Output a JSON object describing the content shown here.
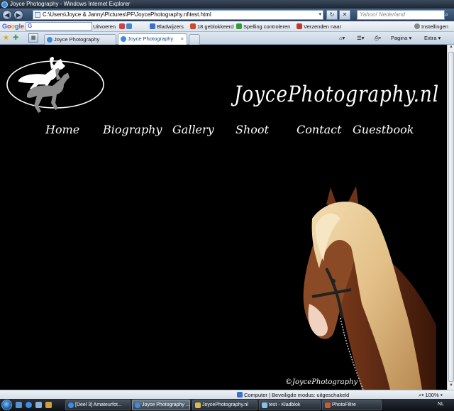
{
  "window": {
    "title": "Joyce Photography - Windows Internet Explorer"
  },
  "address_bar": {
    "url": "C:\\Users\\Joyce & Janny\\Pictures\\PF\\JoycePhotography.nl\\test.html",
    "search_placeholder": "Yahoo! Nederland"
  },
  "google_toolbar": {
    "logo": "Google",
    "go_label": "Uitvoeren",
    "bookmarks_label": "Bladwijzers",
    "blocked_label": "18 geblokkeerd",
    "spellcheck_label": "Spelling controleren",
    "send_label": "Verzenden naar",
    "settings_label": "Instellingen"
  },
  "tabs": [
    {
      "label": "Joyce Photography",
      "active": false
    },
    {
      "label": "Joyce Photography",
      "active": true
    }
  ],
  "command_bar": {
    "page_label": "Pagina",
    "extra_label": "Extra"
  },
  "page": {
    "site_title": "JoycePhotography.nl",
    "nav": [
      "Home",
      "Biography",
      "Gallery",
      "Shoot",
      "Contact",
      "Guestbook"
    ],
    "copyright": "©JoycePhotography"
  },
  "status_bar": {
    "zone": "Computer | Beveiligde modus: uitgeschakeld",
    "zoom": "100%"
  },
  "taskbar": {
    "items": [
      {
        "label": "[Deel 3] Amateurfot...",
        "active": false
      },
      {
        "label": "Joyce Photography ...",
        "active": true
      },
      {
        "label": "JoycePhotography.nl",
        "active": false
      },
      {
        "label": "test - Kladblok",
        "active": false
      },
      {
        "label": "PhotoFiltre",
        "active": false
      }
    ],
    "language": "NL"
  },
  "colors": {
    "page_background": "#000000",
    "page_text": "#ffffff",
    "titlebar": "#1c2633"
  }
}
